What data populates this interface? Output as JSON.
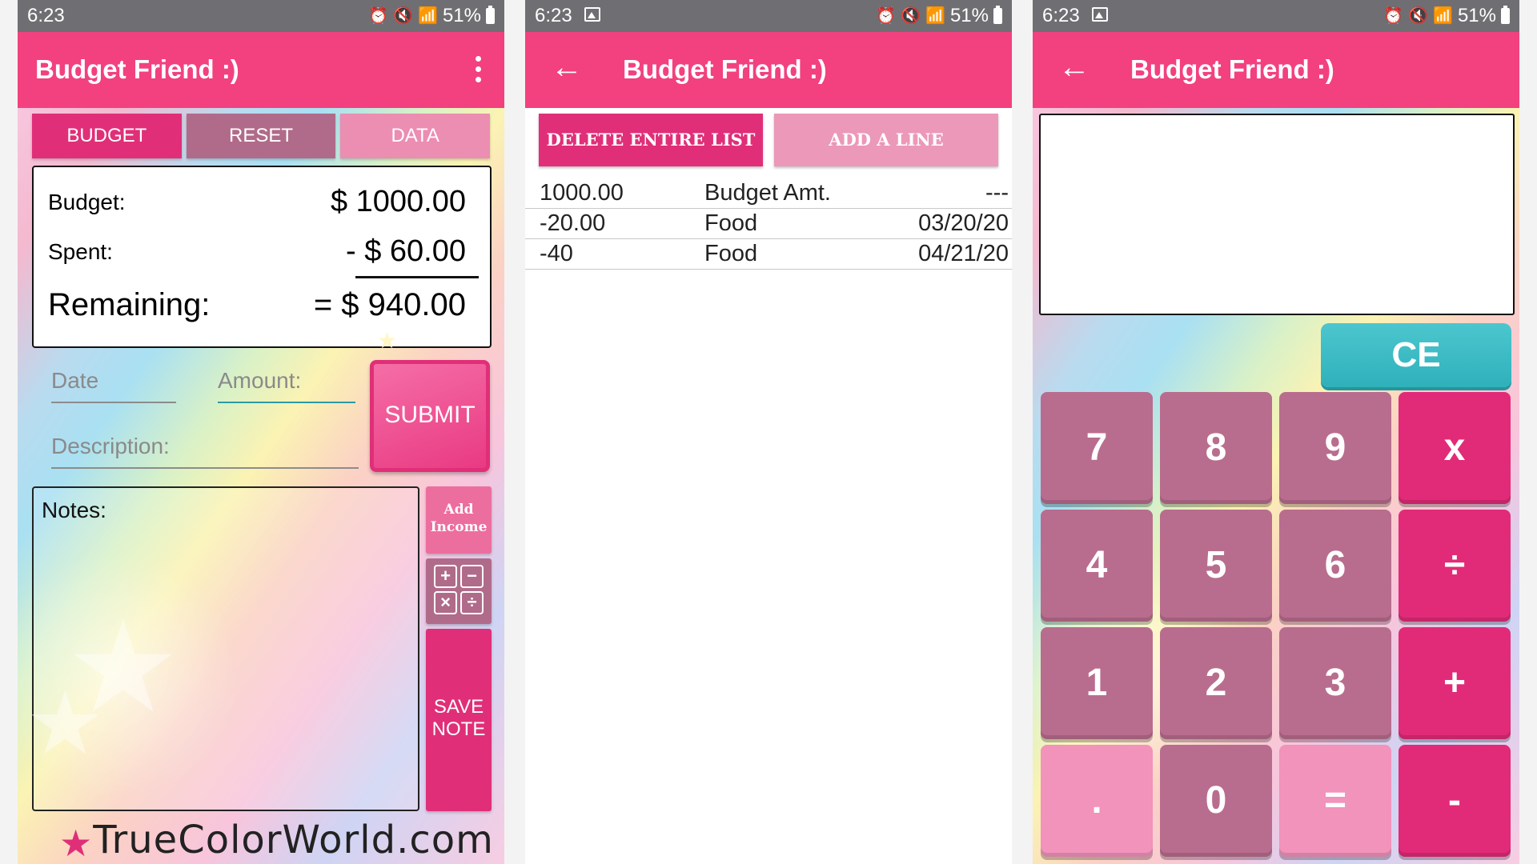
{
  "status": {
    "time": "6:23",
    "battery": "51%"
  },
  "app": {
    "title": "Budget Friend :)"
  },
  "screen1": {
    "tabs": [
      "BUDGET",
      "RESET",
      "DATA"
    ],
    "summary": {
      "budget_label": "Budget:",
      "budget_value": "$ 1000.00",
      "spent_label": "Spent:",
      "spent_value": "- $ 60.00",
      "remaining_label": "Remaining:",
      "remaining_value": "= $ 940.00"
    },
    "inputs": {
      "date_placeholder": "Date",
      "amount_placeholder": "Amount:",
      "description_placeholder": "Description:"
    },
    "submit_label": "SUBMIT",
    "notes_label": "Notes:",
    "add_income_label": "Add Income",
    "save_note_label": "SAVE NOTE",
    "calc_symbols": [
      "+",
      "−",
      "×",
      "÷"
    ],
    "watermark": "TrueColorWorld.com"
  },
  "screen2": {
    "delete_label": "DELETE ENTIRE LIST",
    "add_line_label": "ADD A LINE",
    "rows": [
      {
        "amount": "1000.00",
        "description": "Budget Amt.",
        "date": "---"
      },
      {
        "amount": "-20.00",
        "description": "Food",
        "date": "03/20/20"
      },
      {
        "amount": "-40",
        "description": "Food",
        "date": "04/21/20"
      }
    ]
  },
  "screen3": {
    "clear_label": "CE",
    "keys": [
      "7",
      "8",
      "9",
      "x",
      "4",
      "5",
      "6",
      "÷",
      "1",
      "2",
      "3",
      "+",
      ".",
      "0",
      "=",
      "-"
    ]
  },
  "colors": {
    "appbar": "#f2417e",
    "primary": "#e02f78",
    "muted": "#b16b8a",
    "light": "#ec8db2",
    "teal": "#2fb1ba"
  }
}
